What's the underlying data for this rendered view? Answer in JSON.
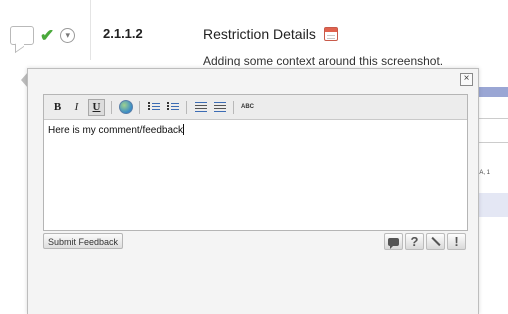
{
  "row": {
    "section_number": "2.1.1.2",
    "title": "Restriction Details",
    "description": "Adding some context around this screenshot."
  },
  "toolbar": {
    "bold": "B",
    "italic": "I",
    "underline": "U",
    "spellcheck": "ABC"
  },
  "editor": {
    "content": "Here is my comment/feedback"
  },
  "popup": {
    "close": "×",
    "submit_label": "Submit Feedback",
    "help": "?",
    "alert": "!"
  },
  "peek": {
    "text": "eA, 1"
  },
  "icons": [
    "comment-bubble-icon",
    "checkmark-icon",
    "chevron-circle-icon",
    "calendar-icon",
    "globe-icon",
    "numbered-list-icon",
    "bulleted-list-icon",
    "outdent-icon",
    "indent-icon",
    "spellcheck-icon",
    "comment-icon",
    "help-icon",
    "pen-icon",
    "alert-icon"
  ],
  "colors": {
    "check": "#4aa93b",
    "calendar": "#e0634f",
    "list_accent": "#3c6cb4"
  }
}
